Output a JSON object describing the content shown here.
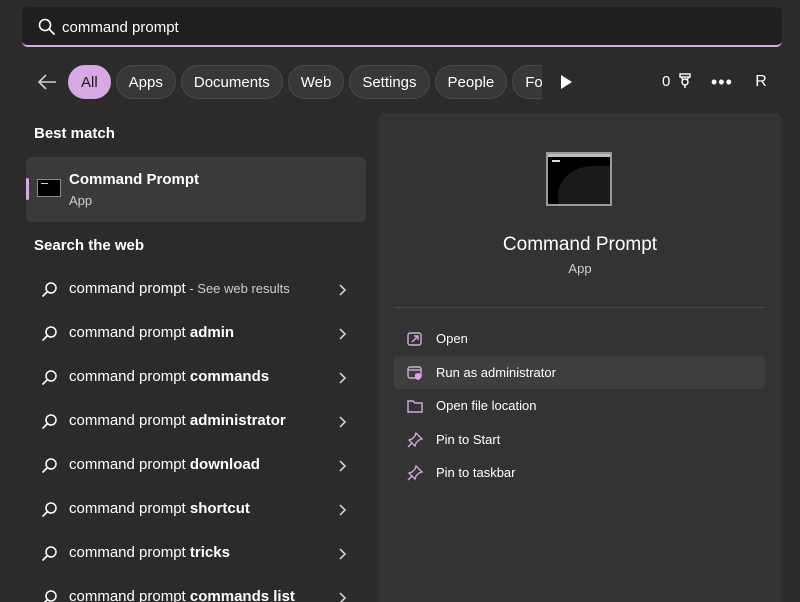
{
  "search": {
    "value": "command prompt",
    "placeholder": ""
  },
  "filters": [
    "All",
    "Apps",
    "Documents",
    "Web",
    "Settings",
    "People",
    "Folde"
  ],
  "toolbar": {
    "points": "0",
    "avatar_initial": "R",
    "more": "•••"
  },
  "best_match": {
    "heading": "Best match",
    "title": "Command Prompt",
    "subtitle": "App"
  },
  "web_search": {
    "heading": "Search the web",
    "items": [
      {
        "prefix": "command prompt",
        "bold": "",
        "suffix": " - See web results"
      },
      {
        "prefix": "command prompt ",
        "bold": "admin",
        "suffix": ""
      },
      {
        "prefix": "command prompt ",
        "bold": "commands",
        "suffix": ""
      },
      {
        "prefix": "command prompt ",
        "bold": "administrator",
        "suffix": ""
      },
      {
        "prefix": "command prompt ",
        "bold": "download",
        "suffix": ""
      },
      {
        "prefix": "command prompt ",
        "bold": "shortcut",
        "suffix": ""
      },
      {
        "prefix": "command prompt ",
        "bold": "tricks",
        "suffix": ""
      },
      {
        "prefix": "command prompt ",
        "bold": "commands list",
        "suffix": ""
      }
    ]
  },
  "detail": {
    "title": "Command Prompt",
    "subtitle": "App",
    "actions": [
      {
        "label": "Open",
        "icon": "open-icon"
      },
      {
        "label": "Run as administrator",
        "icon": "shield-icon"
      },
      {
        "label": "Open file location",
        "icon": "folder-icon"
      },
      {
        "label": "Pin to Start",
        "icon": "pin-icon"
      },
      {
        "label": "Pin to taskbar",
        "icon": "pin-icon"
      }
    ]
  },
  "colors": {
    "accent": "#d6a8e4",
    "background": "#2b2b2b",
    "panel": "#333333"
  }
}
